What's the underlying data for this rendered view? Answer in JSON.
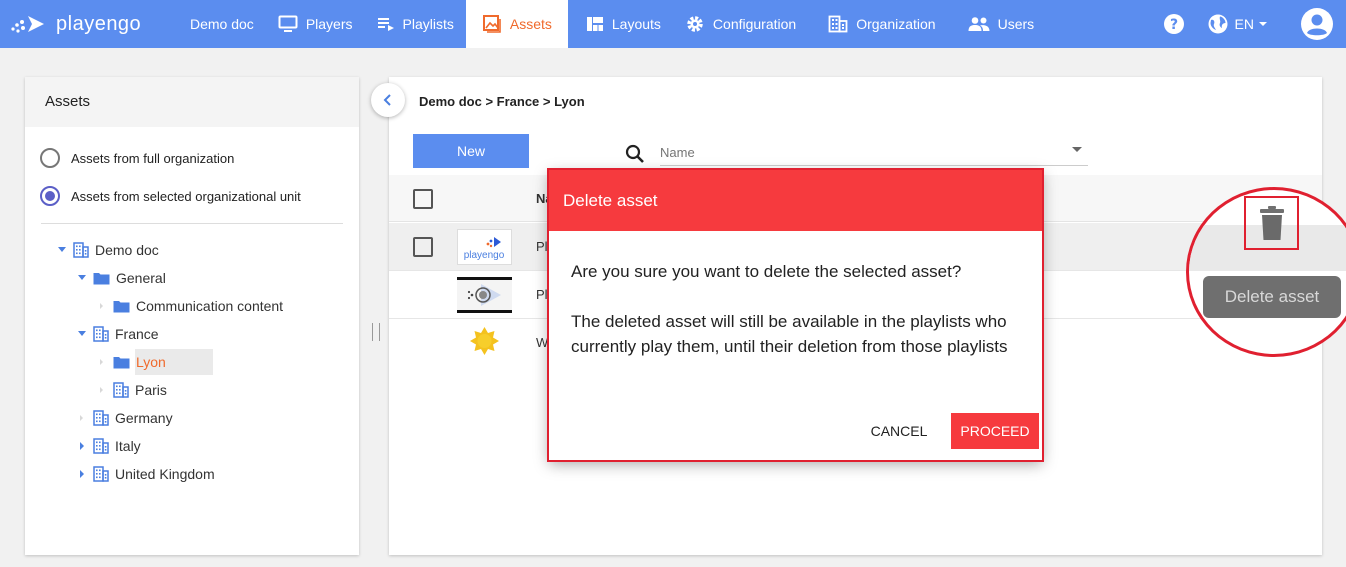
{
  "brand": {
    "name": "playengo"
  },
  "nav": {
    "items": [
      {
        "label": "Demo doc",
        "icon": "none"
      },
      {
        "label": "Players",
        "icon": "monitor-icon"
      },
      {
        "label": "Playlists",
        "icon": "playlist-icon"
      },
      {
        "label": "Assets",
        "icon": "image-icon",
        "active": true
      },
      {
        "label": "Layouts",
        "icon": "layout-icon"
      },
      {
        "label": "Configuration",
        "icon": "gear-icon"
      },
      {
        "label": "Organization",
        "icon": "building-icon"
      },
      {
        "label": "Users",
        "icon": "users-icon"
      }
    ],
    "language": "EN"
  },
  "left_panel": {
    "title": "Assets",
    "radio_full": "Assets from full organization",
    "radio_selected": "Assets from selected organizational unit",
    "tree": [
      {
        "label": "Demo doc"
      },
      {
        "label": "General"
      },
      {
        "label": "Communication content"
      },
      {
        "label": "France"
      },
      {
        "label": "Lyon",
        "selected": true
      },
      {
        "label": "Paris"
      },
      {
        "label": "Germany"
      },
      {
        "label": "Italy"
      },
      {
        "label": "United Kingdom"
      }
    ]
  },
  "main": {
    "breadcrumb": "Demo doc > France > Lyon",
    "new_button": "New",
    "search_placeholder": "Name",
    "column_name": "Na",
    "rows": [
      {
        "name": "Pl"
      },
      {
        "name": "Pl"
      },
      {
        "name": "W"
      }
    ]
  },
  "dialog": {
    "title": "Delete asset",
    "message": "Are you sure you want to delete the selected asset?",
    "note": "The deleted asset will still be available in the playlists who currently play them, until their deletion from those playlists",
    "cancel": "CANCEL",
    "proceed": "PROCEED"
  },
  "callout": {
    "tooltip": "Delete asset"
  },
  "colors": {
    "nav_bg": "#5b8def",
    "active_tab_text": "#f06a2c",
    "dialog_red": "#f63a3e",
    "highlight_red": "#e02030",
    "radio_accent": "#5b5fc7"
  }
}
